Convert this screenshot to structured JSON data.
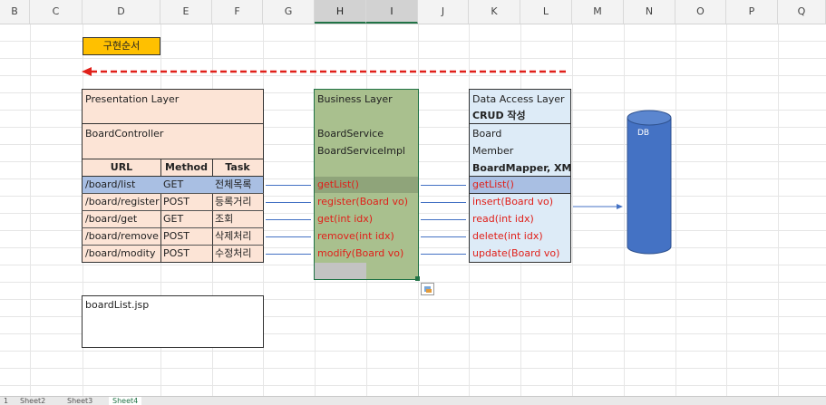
{
  "columns": [
    "B",
    "C",
    "D",
    "E",
    "F",
    "G",
    "H",
    "I",
    "J",
    "K",
    "L",
    "M",
    "N",
    "O",
    "P",
    "Q"
  ],
  "selected_columns": [
    "H",
    "I"
  ],
  "order_label": "구현순서",
  "presentation": {
    "title": "Presentation Layer",
    "controller": "BoardController",
    "headers": [
      "URL",
      "Method",
      "Task"
    ],
    "rows": [
      [
        "/board/list",
        "GET",
        "전체목록"
      ],
      [
        "/board/register",
        "POST",
        "등록거리"
      ],
      [
        "/board/get",
        "GET",
        "조회"
      ],
      [
        "/board/remove",
        "POST",
        "삭제처리"
      ],
      [
        "/board/modity",
        "POST",
        "수정처리"
      ]
    ]
  },
  "business": {
    "title": "Business Layer",
    "service": "BoardService",
    "impl": "BoardServiceImpl",
    "methods": [
      "getList()",
      "register(Board vo)",
      "get(int idx)",
      "remove(int idx)",
      "modify(Board vo)"
    ]
  },
  "data_access": {
    "title": "Data Access Layer",
    "subtitle": "CRUD 작성",
    "items": [
      "Board",
      "Member"
    ],
    "mapper": "BoardMapper, XML",
    "methods": [
      "getList()",
      "insert(Board vo)",
      "read(int idx)",
      "delete(int idx)",
      "update(Board vo)"
    ]
  },
  "db_label": "DB",
  "jsp_label": "boardList.jsp",
  "colors": {
    "accent": "#217346",
    "order_bg": "#ffc000",
    "presentation_bg": "#fce4d6",
    "business_bg": "#a9c08e",
    "data_bg": "#ddebf7",
    "db": "#4472c4",
    "red": "#e0201a"
  },
  "sheet_tabs": [
    "1",
    "Sheet2",
    "Sheet3",
    "Sheet4"
  ]
}
